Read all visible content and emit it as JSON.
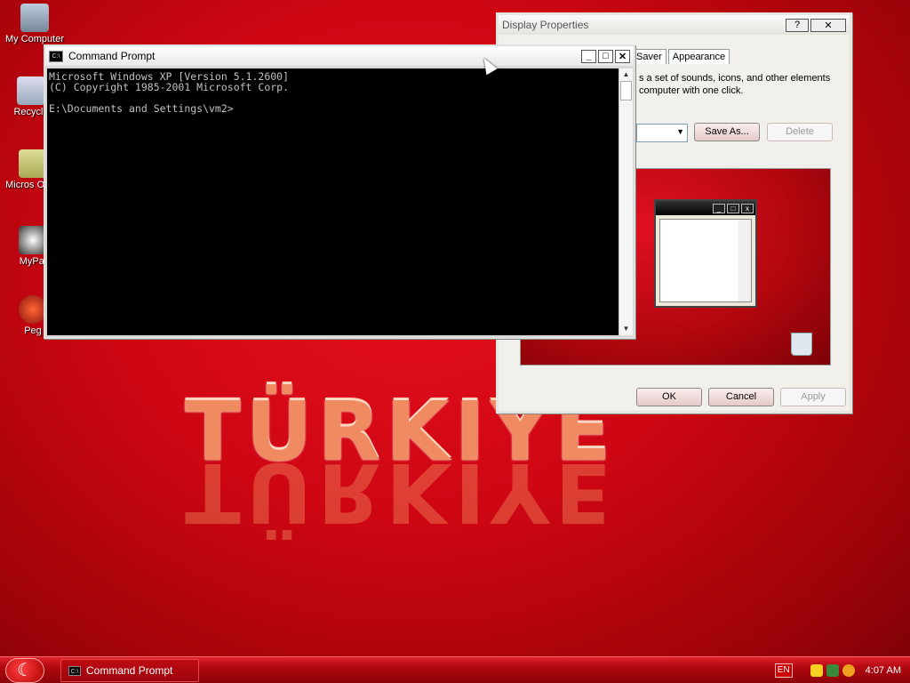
{
  "desktop": {
    "icons": [
      {
        "label": "My Computer"
      },
      {
        "label": "Recycle"
      },
      {
        "label": "Micros Outlo"
      },
      {
        "label": "MyPal"
      },
      {
        "label": "Peg"
      }
    ],
    "wallpaper_text": "TÜRKIYE"
  },
  "display_properties": {
    "title": "Display Properties",
    "help_btn": "?",
    "close_btn": "✕",
    "tabs": [
      "Saver",
      "Appearance"
    ],
    "description": "s a set of sounds, icons, and other elements computer with one click.",
    "save_as": "Save As...",
    "delete": "Delete",
    "ok": "OK",
    "cancel": "Cancel",
    "apply": "Apply"
  },
  "cmd": {
    "title": "Command Prompt",
    "icon_text": "C:\\",
    "lines": "Microsoft Windows XP [Version 5.1.2600]\n(C) Copyright 1985-2001 Microsoft Corp.\n\nE:\\Documents and Settings\\vm2>"
  },
  "taskbar": {
    "task_label": "Command Prompt",
    "lang": "EN",
    "clock": "4:07 AM"
  },
  "colors": {
    "accent": "#cc0612",
    "titlebar_dark": "#000000"
  }
}
